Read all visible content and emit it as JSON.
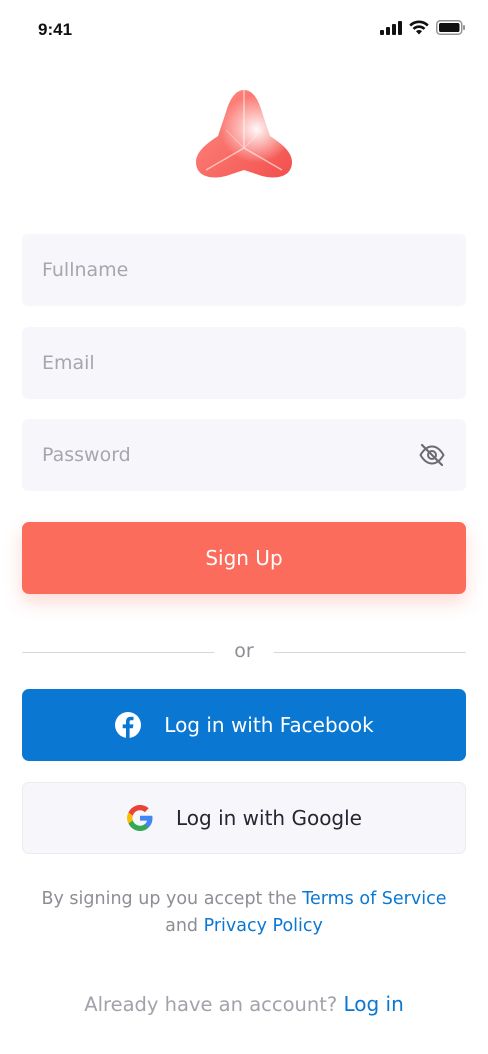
{
  "status_bar": {
    "time": "9:41"
  },
  "logo": {
    "icon": "triangle-logo",
    "colors": [
      "#f55a57",
      "#ffb0a4"
    ]
  },
  "form": {
    "fullname": {
      "placeholder": "Fullname",
      "value": ""
    },
    "email": {
      "placeholder": "Email",
      "value": ""
    },
    "password": {
      "placeholder": "Password",
      "value": "",
      "toggle_icon": "eye-off-icon"
    }
  },
  "buttons": {
    "signup": "Sign Up",
    "facebook": "Log in with Facebook",
    "google": "Log in with Google"
  },
  "divider": {
    "text": "or"
  },
  "legal": {
    "prefix": "By signing up you accept the ",
    "terms_link": "Terms of Service",
    "middle": "and ",
    "privacy_link": "Privacy Policy"
  },
  "footer": {
    "prompt": "Already have an account? ",
    "login_link": "Log in"
  },
  "colors": {
    "primary": "#fb6c5d",
    "facebook": "#0a78d2",
    "link": "#0a78d2",
    "field_bg": "#f7f7fb"
  }
}
